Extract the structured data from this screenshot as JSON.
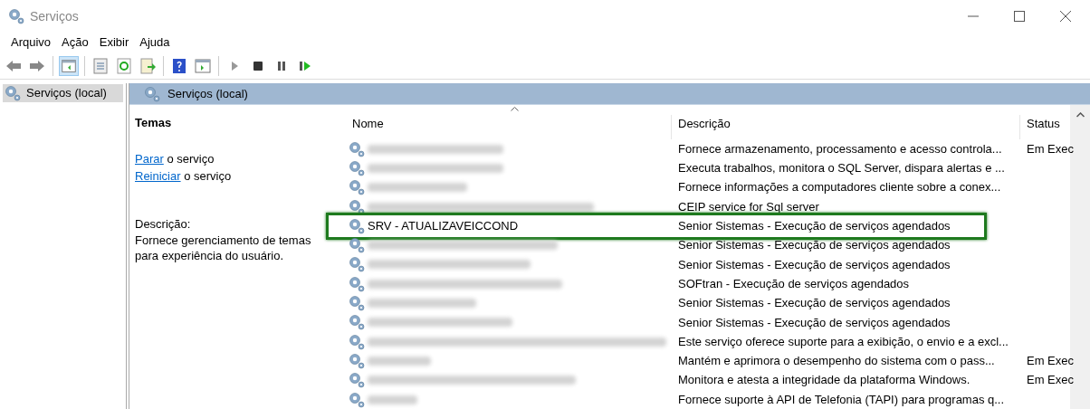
{
  "window": {
    "title": "Serviços"
  },
  "menu": [
    "Arquivo",
    "Ação",
    "Exibir",
    "Ajuda"
  ],
  "tree": [
    {
      "label": "Serviços (local)",
      "selected": true
    }
  ],
  "panel": {
    "header": "Serviços (local)",
    "service_title": "Temas",
    "actions": [
      {
        "link": "Parar",
        "rest": " o serviço"
      },
      {
        "link": "Reiniciar",
        "rest": " o serviço"
      }
    ],
    "description_label": "Descrição:",
    "description": "Fornece gerenciamento de temas para experiência do usuário."
  },
  "table": {
    "columns": [
      "Nome",
      "Descrição",
      "Status"
    ],
    "rows": [
      {
        "kind": "blurred",
        "description": "Fornece armazenamento, processamento e acesso controla...",
        "status": "Em Exec",
        "highlighted": false
      },
      {
        "kind": "blurred",
        "description": "Executa trabalhos, monitora o SQL Server, dispara alertas e ...",
        "highlighted": false
      },
      {
        "kind": "blurred",
        "description": "Fornece informações a computadores cliente sobre a conex...",
        "highlighted": false
      },
      {
        "kind": "blurred",
        "description": "CEIP service for Sql server",
        "highlighted": false
      },
      {
        "kind": "named",
        "name": "SRV - ATUALIZAVEICCOND",
        "description": "Senior Sistemas - Execução de serviços agendados",
        "highlighted": true
      },
      {
        "kind": "blurred",
        "description": "Senior Sistemas - Execução de serviços agendados",
        "highlighted": false
      },
      {
        "kind": "blurred",
        "description": "Senior Sistemas - Execução de serviços agendados",
        "highlighted": false
      },
      {
        "kind": "blurred",
        "description": "SOFtran - Execução de serviços agendados",
        "highlighted": false
      },
      {
        "kind": "blurred",
        "description": "Senior Sistemas - Execução de serviços agendados",
        "highlighted": false
      },
      {
        "kind": "blurred",
        "description": "Senior Sistemas - Execução de serviços agendados",
        "highlighted": false
      },
      {
        "kind": "blurred",
        "description": "Este serviço oferece suporte para a exibição, o envio e a excl...",
        "highlighted": false
      },
      {
        "kind": "blurred",
        "description": "Mantém e aprimora o desempenho do sistema com o pass...",
        "status": "Em Exec",
        "highlighted": false
      },
      {
        "kind": "blurred",
        "description": "Monitora e atesta a integridade da plataforma Windows.",
        "status": "Em Exec",
        "highlighted": false
      },
      {
        "kind": "blurred",
        "description": "Fornece suporte à API de Telefonia (TAPI) para programas q...",
        "highlighted": false
      }
    ]
  }
}
